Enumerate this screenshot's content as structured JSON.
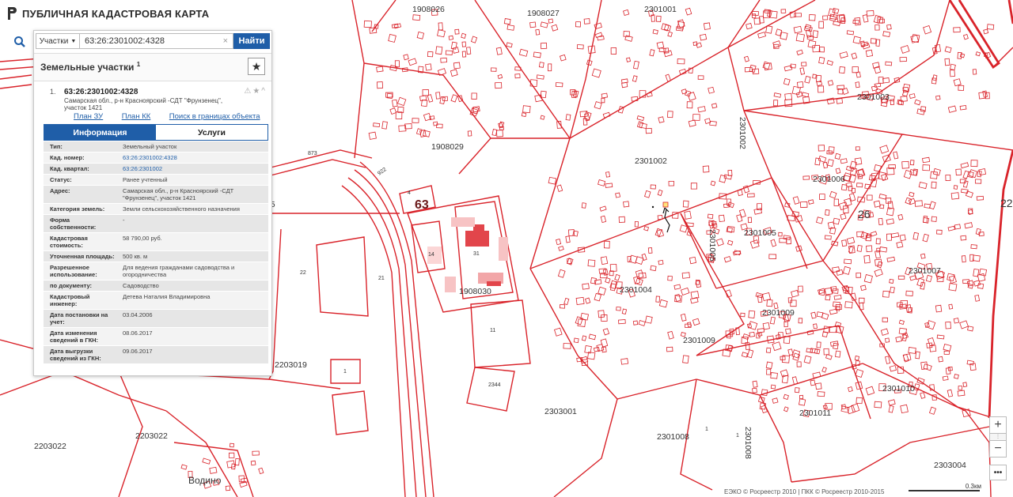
{
  "app": {
    "title": "ПУБЛИЧНАЯ КАДАСТРОВАЯ КАРТА"
  },
  "search": {
    "type_label": "Участки",
    "query": "63:26:2301002:4328",
    "button_label": "Найти",
    "clear_symbol": "×"
  },
  "results": {
    "section_title": "Земельные участки",
    "count": "1",
    "favorite_symbol": "★",
    "item": {
      "index": "1.",
      "number": "63:26:2301002:4328",
      "address": "Самарская обл., р-н Красноярский -СДТ \"Фрунзенец\", участок 1421",
      "links": [
        "План ЗУ →",
        "План КК →",
        "Поиск в границах объекта →"
      ],
      "actions": "⚠★^"
    }
  },
  "tabs": [
    "Информация",
    "Услуги"
  ],
  "info": [
    {
      "label": "Тип:",
      "value": "Земельный участок"
    },
    {
      "label": "Кад. номер:",
      "value": "63:26:2301002:4328",
      "link": true
    },
    {
      "label": "Кад. квартал:",
      "value": "63:26:2301002",
      "link": true
    },
    {
      "label": "Статус:",
      "value": "Ранее учтенный"
    },
    {
      "label": "Адрес:",
      "value": "Самарская обл., р-н Красноярский -СДТ \"Фрунзенец\", участок 1421"
    },
    {
      "label": "Категория земель:",
      "value": "Земли сельскохозяйственного назначения"
    },
    {
      "label": "Форма собственности:",
      "value": "-"
    },
    {
      "label": "Кадастровая стоимость:",
      "value": "58 790,00 руб."
    },
    {
      "label": "Уточненная площадь:",
      "value": "500 кв. м"
    },
    {
      "label": "Разрешенное использование:",
      "value": "Для ведения гражданами садоводства и огородничества"
    },
    {
      "label": "по документу:",
      "value": "Садоводство"
    },
    {
      "label": "Кадастровый инженер:",
      "value": "Детева Наталия Владимировна"
    },
    {
      "label": "Дата постановки на учет:",
      "value": "03.04.2006"
    },
    {
      "label": "Дата изменения сведений в ГКН:",
      "value": "08.06.2017"
    },
    {
      "label": "Дата выгрузки сведений из ГКН:",
      "value": "09.06.2017"
    }
  ],
  "map": {
    "parcel_color": "#d9232a",
    "labels": {
      "q1908026": "1908026",
      "q1908027": "1908027",
      "q2301001": "2301001",
      "q2301003": "2301003",
      "q2301002v": "2301002",
      "q1908029": "1908029",
      "q2301002": "2301002",
      "q2301006": "2301006",
      "q26": "26",
      "q22": "22",
      "q2301005v": "2301005",
      "q2301005": "2301005",
      "q2301007": "2301007",
      "q2301004": "2301004",
      "q2301009": "2301009",
      "q2301009b": "2301009",
      "q1908030": "1908030",
      "q2203019": "2203019",
      "q2303001": "2303001",
      "q2301010": "2301010",
      "q2301011": "2301011",
      "q2301008": "2301008",
      "q2301008v": "2301008",
      "q2303004": "2303004",
      "q2203022a": "2203022",
      "q2203022b": "2203022",
      "q63": "63",
      "n873": "873",
      "n922": "922",
      "n4": "4",
      "n14": "14",
      "n31": "31",
      "n21": "21",
      "n22": "22",
      "n11": "11",
      "n2344": "2344",
      "n1a": "1",
      "n1b": "1",
      "n1c": "1",
      "n5": "5",
      "vodino": "Водино"
    }
  },
  "controls": {
    "zoom_in": "+",
    "zoom_out": "−",
    "menu": "•••",
    "slider": "⋮"
  },
  "attribution": "ЕЭКО © Росреестр 2010 | ПКК © Росреестр 2010-2015",
  "scale_label": "0.3км"
}
